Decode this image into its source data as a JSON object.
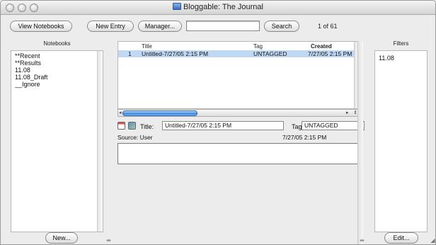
{
  "window": {
    "title": "Bloggable:  The Journal"
  },
  "toolbar": {
    "view_notebooks_label": "View Notebooks",
    "new_entry_label": "New Entry",
    "manager_label": "Manager...",
    "search_value": "",
    "search_button_label": "Search",
    "page_counter": "1 of 61"
  },
  "notebooks": {
    "header": "Notebooks",
    "items": [
      "**Recent",
      "**Results",
      "11.08",
      "11.08_Draft",
      "__Ignore"
    ],
    "new_button_label": "New..."
  },
  "entries": {
    "columns": {
      "index": "",
      "title": "Title",
      "tag": "Tag",
      "created": "Created"
    },
    "rows": [
      {
        "index": "1",
        "title": "Untitled-7/27/05 2:15 PM",
        "tag": "UNTAGGED",
        "created": "7/27/05 2:15 PM I"
      }
    ]
  },
  "detail": {
    "title_label": "Title:",
    "title_value": "Untitled-7/27/05 2:15 PM",
    "tag_label": "Tag:",
    "tag_value": "UNTAGGED",
    "source_text": "Source: User",
    "date_text": "7/27/05 2:15 PM",
    "body_text": ""
  },
  "filters": {
    "header": "Filters",
    "items": [
      "11.08"
    ],
    "edit_button_label": "Edit..."
  },
  "icons": {
    "close": "window-close-icon",
    "minimize": "window-minimize-icon",
    "zoom": "window-zoom-icon",
    "document": "document-icon",
    "calendar": "calendar-icon",
    "image": "image-icon",
    "resize_grip": "resize-grip-icon"
  }
}
